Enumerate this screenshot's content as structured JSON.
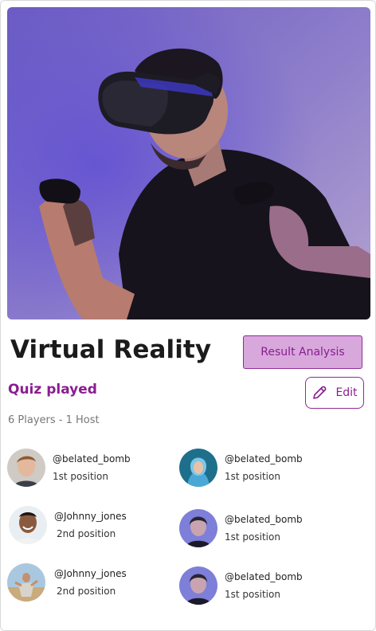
{
  "card": {
    "title": "Virtual Reality",
    "subtitle": "Quiz played",
    "players_info": "6 Players - 1 Host",
    "result_button": "Result Analysis",
    "edit_button": "Edit",
    "accent": "#8a1d90",
    "accent_bg": "#d8a8dc"
  },
  "hero": {
    "icon": "vr-headset-photo"
  },
  "players": [
    {
      "handle": "@belated_bomb",
      "position": "1st position",
      "avatar": "avatar-man-smiling"
    },
    {
      "handle": "@belated_bomb",
      "position": "1st position",
      "avatar": "avatar-hooded-person"
    },
    {
      "handle": "@Johnny_jones",
      "position": "2nd position",
      "avatar": "avatar-man-smiling-dark"
    },
    {
      "handle": "@belated_bomb",
      "position": "1st position",
      "avatar": "avatar-woman-blue"
    },
    {
      "handle": "@Johnny_jones",
      "position": "2nd position",
      "avatar": "avatar-person-outdoors"
    },
    {
      "handle": "@belated_bomb",
      "position": "1st position",
      "avatar": "avatar-woman-blue"
    }
  ]
}
